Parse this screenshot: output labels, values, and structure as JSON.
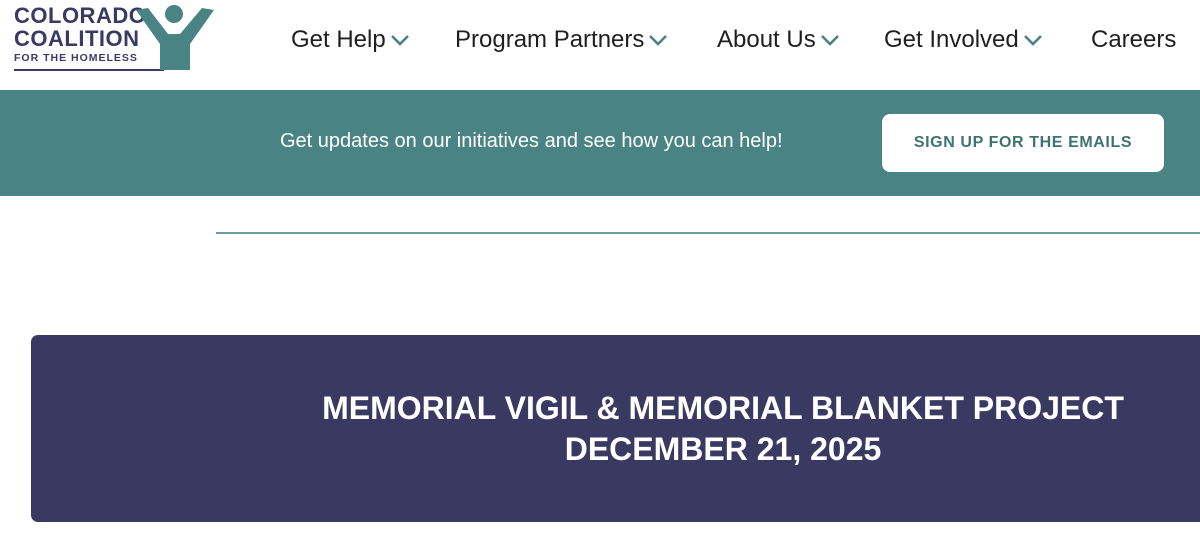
{
  "logo": {
    "line1": "COLORADO",
    "line2": "COALITION",
    "line3": "FOR THE HOMELESS",
    "colors": {
      "text": "#3a3a63",
      "figure": "#4a8383"
    }
  },
  "nav": {
    "items": [
      {
        "label": "Get Help",
        "has_dropdown": true
      },
      {
        "label": "Program Partners",
        "has_dropdown": true
      },
      {
        "label": "About Us",
        "has_dropdown": true
      },
      {
        "label": "Get Involved",
        "has_dropdown": true
      },
      {
        "label": "Careers",
        "has_dropdown": false
      }
    ],
    "chevron_icon": "chevron-down-icon",
    "chevron_color": "#4a8383"
  },
  "banner": {
    "text": "Get updates on our initiatives and see how you can help!",
    "button_label": "SIGN UP FOR THE EMAILS",
    "background": "#4a8383"
  },
  "hero": {
    "title_line1": "MEMORIAL VIGIL & MEMORIAL BLANKET PROJECT",
    "title_line2": "DECEMBER 21, 2025",
    "background": "#3a3961"
  }
}
